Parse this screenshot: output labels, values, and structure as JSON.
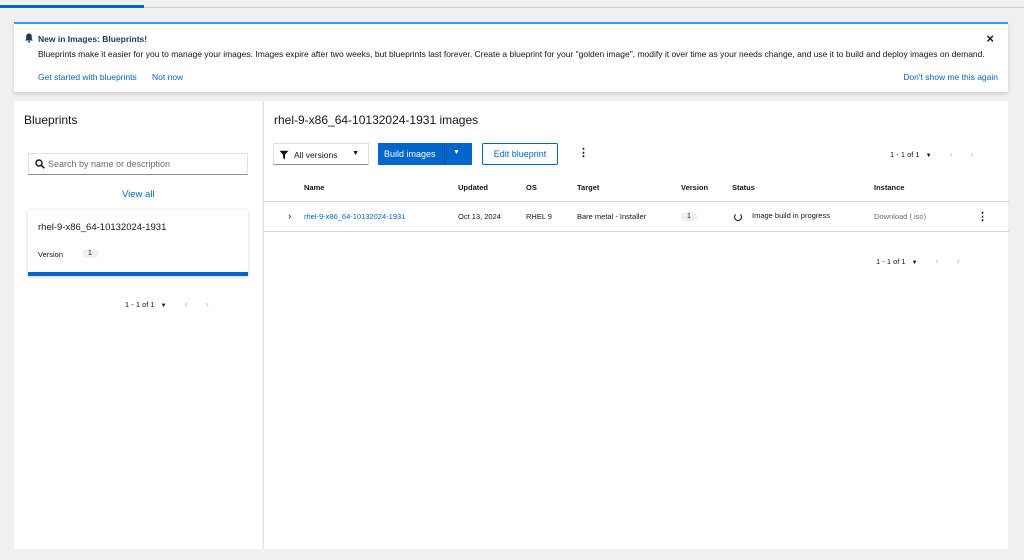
{
  "alert": {
    "title": "New in Images: Blueprints!",
    "description": "Blueprints make it easier for you to manage your images. Images expire after two weeks, but blueprints last forever. Create a blueprint for your \"golden image\", modify it over time as your needs change, and use it to build and deploy images on demand.",
    "get_started": "Get started with blueprints",
    "not_now": "Not now",
    "dont_show": "Don't show me this again",
    "close": "×"
  },
  "sidebar": {
    "title": "Blueprints",
    "search_placeholder": "Search by name or description",
    "view_all": "View all",
    "card": {
      "name": "rhel-9-x86_64-10132024-1931",
      "version_label": "Version",
      "version": "1"
    },
    "pager": {
      "range": "1 - 1 of 1"
    }
  },
  "main": {
    "title": "rhel-9-x86_64-10132024-1931 images",
    "filter_label": "All versions",
    "build_label": "Build images",
    "edit_label": "Edit blueprint",
    "pager_top": "1 - 1 of 1",
    "pager_bottom": "1 - 1 of 1",
    "columns": [
      "Name",
      "Updated",
      "OS",
      "Target",
      "Version",
      "Status",
      "Instance"
    ],
    "rows": [
      {
        "name": "rhel-9-x86_64-10132024-1931",
        "updated": "Oct 13, 2024",
        "os": "RHEL 9",
        "target": "Bare metal - Installer",
        "version": "1",
        "status": "Image build in progress",
        "instance": "Download (.iso)"
      }
    ]
  },
  "icons": {
    "bell": "bell-icon",
    "search": "search-icon",
    "filter": "filter-icon",
    "spinner": "spinner-icon",
    "kebab": "kebab-icon"
  },
  "colors": {
    "primary": "#0066cc",
    "info_border": "#2b9af3"
  }
}
